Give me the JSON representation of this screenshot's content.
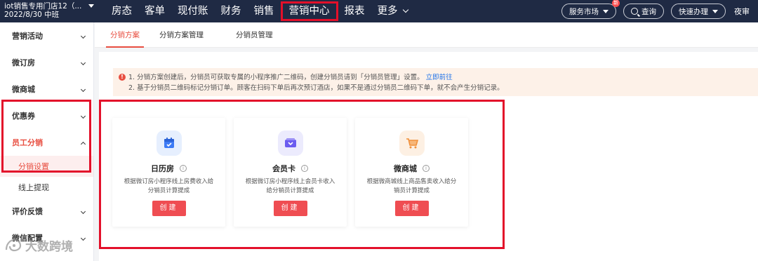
{
  "header": {
    "store_name": "iot销售专用门店12（...",
    "store_date": "2022/8/30 中班",
    "nav": [
      "房态",
      "客单",
      "现付账",
      "财务",
      "销售",
      "营销中心",
      "报表",
      "更多"
    ],
    "service_market": "服务市场",
    "service_badge": "新",
    "search": "查询",
    "quick_action": "快速办理",
    "night_audit": "夜审"
  },
  "sidebar": {
    "groups": [
      "营销活动",
      "微订房",
      "微商城",
      "优惠券",
      "员工分销",
      "评价反馈",
      "微信配置"
    ],
    "sub_items": [
      "分销设置",
      "线上提现"
    ]
  },
  "tabs": [
    "分销方案",
    "分销方案管理",
    "分销员管理"
  ],
  "notice": {
    "line1": "1. 分销方案创建后，分销员可获取专属的小程序推广二维码，创建分销员请到「分销员管理」设置。",
    "link": "立即前往",
    "line2": "2. 基于分销员二维码标记分销订单。顾客在扫码下单后再次预订酒店，如果不是通过分销员二维码下单，就不会产生分销记录。"
  },
  "cards": [
    {
      "title": "日历房",
      "desc": "根据微订房小程序线上房费收入给分销员计算提成",
      "button": "创建",
      "icon": "calendar-icon",
      "color": "#3d7bf5"
    },
    {
      "title": "会员卡",
      "desc": "根据微订房小程序线上会员卡收入给分销员计算提成",
      "button": "创建",
      "icon": "member-card-icon",
      "color": "#6b5cf0"
    },
    {
      "title": "微商城",
      "desc": "根据微商城线上商品售卖收入给分销员计算提成",
      "button": "创建",
      "icon": "shopping-cart-icon",
      "color": "#f0913d"
    }
  ],
  "watermark": "大数跨境"
}
